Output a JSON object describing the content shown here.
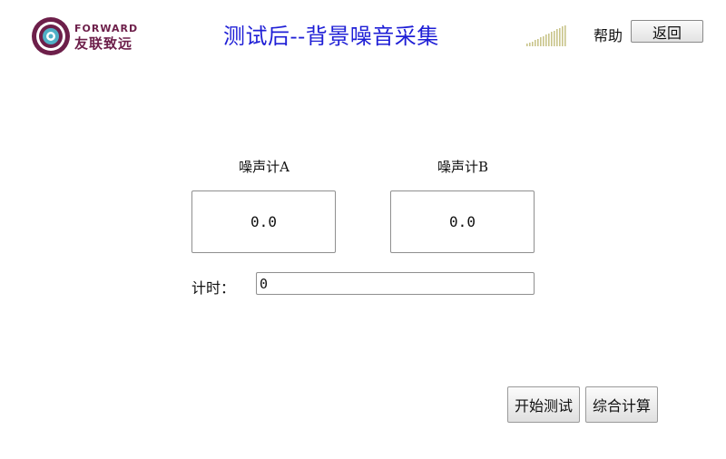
{
  "brand": {
    "logo_text_en": "FORWARD",
    "logo_text_cn": "友联致远"
  },
  "header": {
    "title": "测试后--背景噪音采集",
    "help_label": "帮助",
    "back_label": "返回",
    "signal_icon": "signal-strength-icon"
  },
  "meters": [
    {
      "label": "噪声计A",
      "value": "0.0"
    },
    {
      "label": "噪声计B",
      "value": "0.0"
    }
  ],
  "timer": {
    "label": "计时：",
    "value": "0"
  },
  "actions": {
    "start_label": "开始测试",
    "calc_label": "综合计算"
  },
  "colors": {
    "title": "#1f1fd6",
    "brand": "#6d1f4a",
    "signal": "#c9c48a"
  }
}
